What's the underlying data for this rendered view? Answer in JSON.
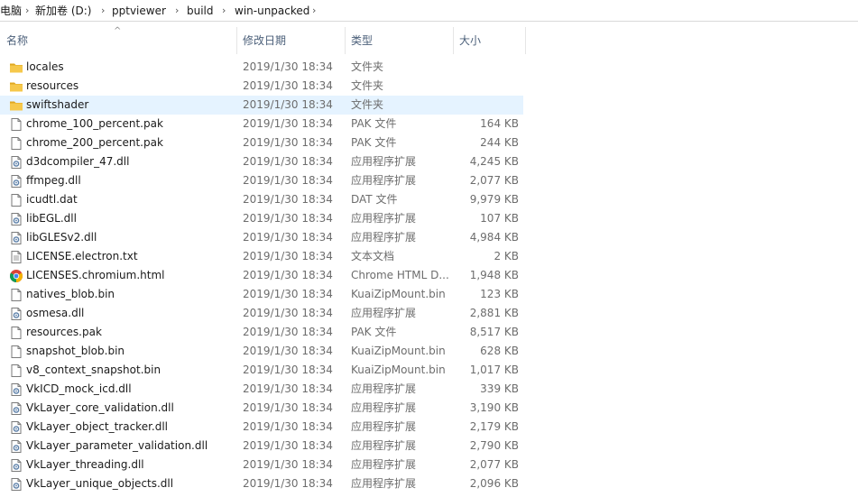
{
  "breadcrumb": {
    "items": [
      "电脑",
      "新加卷 (D:)",
      "pptviewer",
      "build",
      "win-unpacked"
    ],
    "separator": "›"
  },
  "columns": {
    "name": "名称",
    "date": "修改日期",
    "type": "类型",
    "size": "大小"
  },
  "selected_row": 2,
  "files": [
    {
      "name": "locales",
      "date": "2019/1/30 18:34",
      "type": "文件夹",
      "size": "",
      "icon": "folder-icon"
    },
    {
      "name": "resources",
      "date": "2019/1/30 18:34",
      "type": "文件夹",
      "size": "",
      "icon": "folder-icon"
    },
    {
      "name": "swiftshader",
      "date": "2019/1/30 18:34",
      "type": "文件夹",
      "size": "",
      "icon": "folder-icon"
    },
    {
      "name": "chrome_100_percent.pak",
      "date": "2019/1/30 18:34",
      "type": "PAK 文件",
      "size": "164 KB",
      "icon": "file-icon"
    },
    {
      "name": "chrome_200_percent.pak",
      "date": "2019/1/30 18:34",
      "type": "PAK 文件",
      "size": "244 KB",
      "icon": "file-icon"
    },
    {
      "name": "d3dcompiler_47.dll",
      "date": "2019/1/30 18:34",
      "type": "应用程序扩展",
      "size": "4,245 KB",
      "icon": "dll-icon"
    },
    {
      "name": "ffmpeg.dll",
      "date": "2019/1/30 18:34",
      "type": "应用程序扩展",
      "size": "2,077 KB",
      "icon": "dll-icon"
    },
    {
      "name": "icudtl.dat",
      "date": "2019/1/30 18:34",
      "type": "DAT 文件",
      "size": "9,979 KB",
      "icon": "file-icon"
    },
    {
      "name": "libEGL.dll",
      "date": "2019/1/30 18:34",
      "type": "应用程序扩展",
      "size": "107 KB",
      "icon": "dll-icon"
    },
    {
      "name": "libGLESv2.dll",
      "date": "2019/1/30 18:34",
      "type": "应用程序扩展",
      "size": "4,984 KB",
      "icon": "dll-icon"
    },
    {
      "name": "LICENSE.electron.txt",
      "date": "2019/1/30 18:34",
      "type": "文本文档",
      "size": "2 KB",
      "icon": "text-file-icon"
    },
    {
      "name": "LICENSES.chromium.html",
      "date": "2019/1/30 18:34",
      "type": "Chrome HTML D...",
      "size": "1,948 KB",
      "icon": "chrome-icon"
    },
    {
      "name": "natives_blob.bin",
      "date": "2019/1/30 18:34",
      "type": "KuaiZipMount.bin",
      "size": "123 KB",
      "icon": "file-icon"
    },
    {
      "name": "osmesa.dll",
      "date": "2019/1/30 18:34",
      "type": "应用程序扩展",
      "size": "2,881 KB",
      "icon": "dll-icon"
    },
    {
      "name": "resources.pak",
      "date": "2019/1/30 18:34",
      "type": "PAK 文件",
      "size": "8,517 KB",
      "icon": "file-icon"
    },
    {
      "name": "snapshot_blob.bin",
      "date": "2019/1/30 18:34",
      "type": "KuaiZipMount.bin",
      "size": "628 KB",
      "icon": "file-icon"
    },
    {
      "name": "v8_context_snapshot.bin",
      "date": "2019/1/30 18:34",
      "type": "KuaiZipMount.bin",
      "size": "1,017 KB",
      "icon": "file-icon"
    },
    {
      "name": "VkICD_mock_icd.dll",
      "date": "2019/1/30 18:34",
      "type": "应用程序扩展",
      "size": "339 KB",
      "icon": "dll-icon"
    },
    {
      "name": "VkLayer_core_validation.dll",
      "date": "2019/1/30 18:34",
      "type": "应用程序扩展",
      "size": "3,190 KB",
      "icon": "dll-icon"
    },
    {
      "name": "VkLayer_object_tracker.dll",
      "date": "2019/1/30 18:34",
      "type": "应用程序扩展",
      "size": "2,179 KB",
      "icon": "dll-icon"
    },
    {
      "name": "VkLayer_parameter_validation.dll",
      "date": "2019/1/30 18:34",
      "type": "应用程序扩展",
      "size": "2,790 KB",
      "icon": "dll-icon"
    },
    {
      "name": "VkLayer_threading.dll",
      "date": "2019/1/30 18:34",
      "type": "应用程序扩展",
      "size": "2,077 KB",
      "icon": "dll-icon"
    },
    {
      "name": "VkLayer_unique_objects.dll",
      "date": "2019/1/30 18:34",
      "type": "应用程序扩展",
      "size": "2,096 KB",
      "icon": "dll-icon"
    }
  ],
  "colors": {
    "selection": "#e5f3ff",
    "header_text": "#4c607a",
    "folder": "#f6c84b",
    "folder_dark": "#e0a821"
  }
}
